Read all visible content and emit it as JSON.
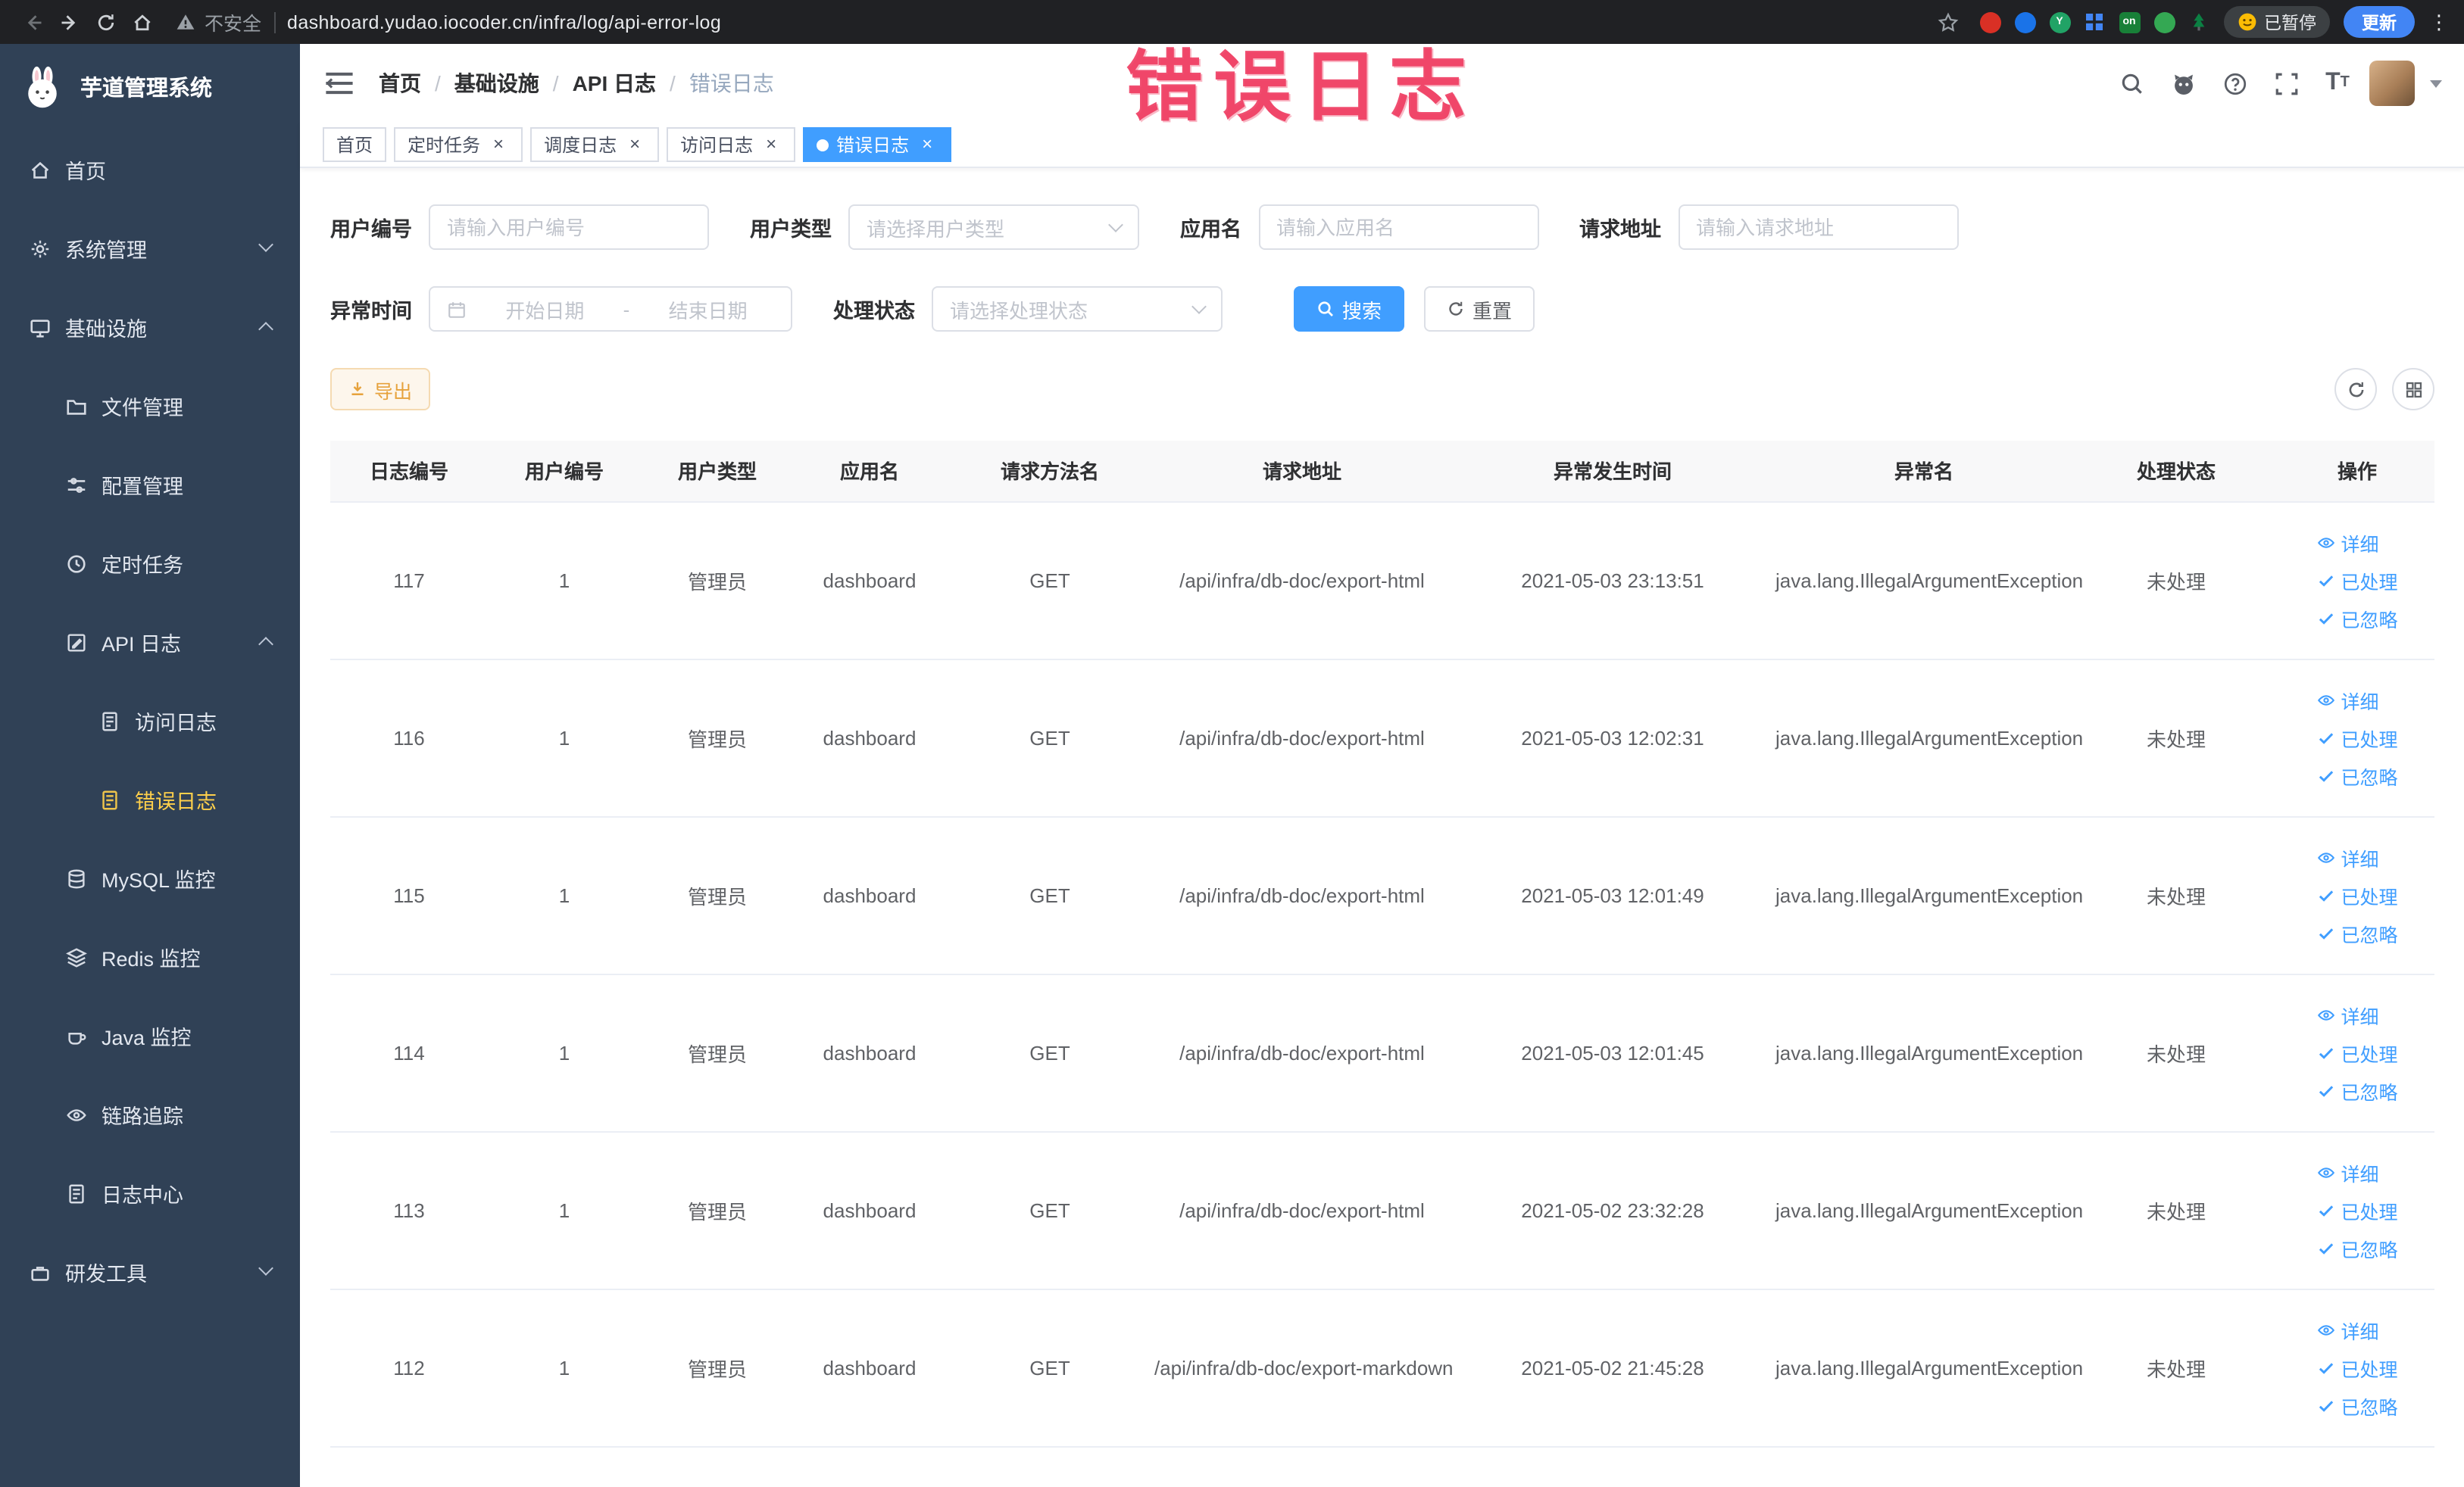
{
  "browser": {
    "security": "不安全",
    "url": "dashboard.yudao.iocoder.cn/infra/log/api-error-log",
    "paused": "已暂停",
    "update": "更新",
    "extension_badge": "on",
    "extension_letter": "Y"
  },
  "annotation": "错误日志",
  "sidebar": {
    "title": "芋道管理系统",
    "items": [
      {
        "label": "首页"
      },
      {
        "label": "系统管理"
      },
      {
        "label": "基础设施"
      },
      {
        "label": "文件管理"
      },
      {
        "label": "配置管理"
      },
      {
        "label": "定时任务"
      },
      {
        "label": "API 日志"
      },
      {
        "label": "访问日志"
      },
      {
        "label": "错误日志"
      },
      {
        "label": "MySQL 监控"
      },
      {
        "label": "Redis 监控"
      },
      {
        "label": "Java 监控"
      },
      {
        "label": "链路追踪"
      },
      {
        "label": "日志中心"
      },
      {
        "label": "研发工具"
      }
    ]
  },
  "breadcrumb": {
    "items": [
      "首页",
      "基础设施",
      "API 日志",
      "错误日志"
    ],
    "separator": "/"
  },
  "tabs": [
    {
      "label": "首页"
    },
    {
      "label": "定时任务"
    },
    {
      "label": "调度日志"
    },
    {
      "label": "访问日志"
    },
    {
      "label": "错误日志"
    }
  ],
  "filters": {
    "user_id": {
      "label": "用户编号",
      "placeholder": "请输入用户编号"
    },
    "user_type": {
      "label": "用户类型",
      "placeholder": "请选择用户类型"
    },
    "app_name": {
      "label": "应用名",
      "placeholder": "请输入应用名"
    },
    "request_url": {
      "label": "请求地址",
      "placeholder": "请输入请求地址"
    },
    "exception_time": {
      "label": "异常时间",
      "start": "开始日期",
      "separator": "-",
      "end": "结束日期"
    },
    "process_status": {
      "label": "处理状态",
      "placeholder": "请选择处理状态"
    },
    "search": "搜索",
    "reset": "重置"
  },
  "toolbar": {
    "export": "导出"
  },
  "table": {
    "columns": [
      "日志编号",
      "用户编号",
      "用户类型",
      "应用名",
      "请求方法名",
      "请求地址",
      "异常发生时间",
      "异常名",
      "处理状态",
      "操作"
    ],
    "rows": [
      {
        "id": "117",
        "user_id": "1",
        "user_type": "管理员",
        "app": "dashboard",
        "method": "GET",
        "url": "/api/infra/db-doc/export-html",
        "time": "2021-05-03 23:13:51",
        "exception": "java.lang.IllegalArgumentException",
        "status": "未处理"
      },
      {
        "id": "116",
        "user_id": "1",
        "user_type": "管理员",
        "app": "dashboard",
        "method": "GET",
        "url": "/api/infra/db-doc/export-html",
        "time": "2021-05-03 12:02:31",
        "exception": "java.lang.IllegalArgumentException",
        "status": "未处理"
      },
      {
        "id": "115",
        "user_id": "1",
        "user_type": "管理员",
        "app": "dashboard",
        "method": "GET",
        "url": "/api/infra/db-doc/export-html",
        "time": "2021-05-03 12:01:49",
        "exception": "java.lang.IllegalArgumentException",
        "status": "未处理"
      },
      {
        "id": "114",
        "user_id": "1",
        "user_type": "管理员",
        "app": "dashboard",
        "method": "GET",
        "url": "/api/infra/db-doc/export-html",
        "time": "2021-05-03 12:01:45",
        "exception": "java.lang.IllegalArgumentException",
        "status": "未处理"
      },
      {
        "id": "113",
        "user_id": "1",
        "user_type": "管理员",
        "app": "dashboard",
        "method": "GET",
        "url": "/api/infra/db-doc/export-html",
        "time": "2021-05-02 23:32:28",
        "exception": "java.lang.IllegalArgumentException",
        "status": "未处理"
      },
      {
        "id": "112",
        "user_id": "1",
        "user_type": "管理员",
        "app": "dashboard",
        "method": "GET",
        "url": "/api/infra/db-doc/export-markdown",
        "time": "2021-05-02 21:45:28",
        "exception": "java.lang.IllegalArgumentException",
        "status": "未处理"
      }
    ]
  },
  "actions": {
    "detail": "详细",
    "process": "已处理",
    "ignore": "已忽略"
  }
}
